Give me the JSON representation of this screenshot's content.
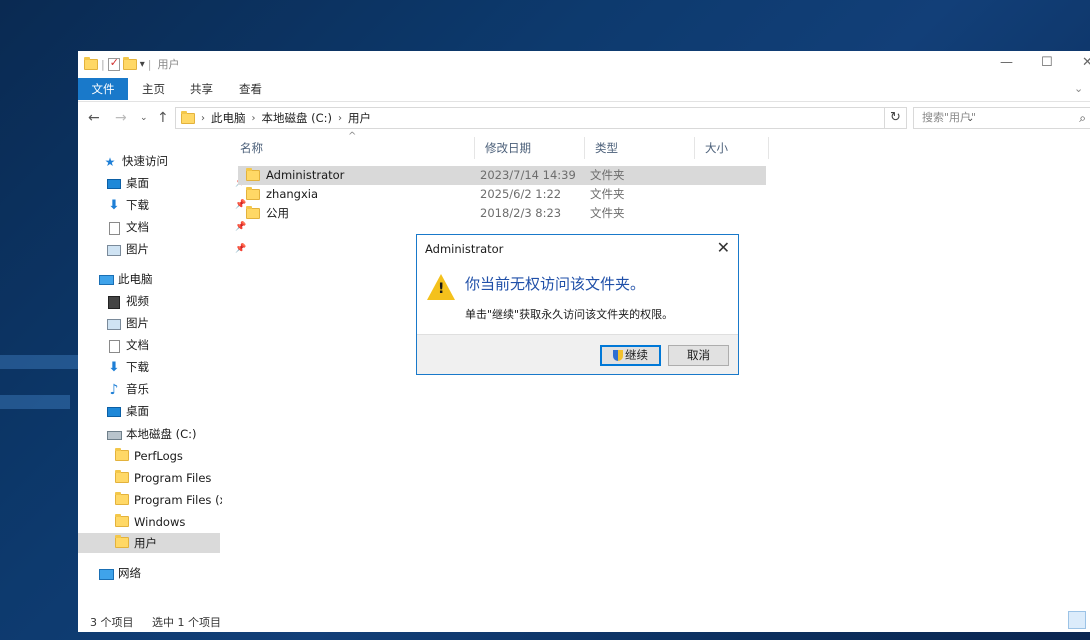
{
  "window": {
    "title": "用户",
    "controls": {
      "minimize": "—",
      "maximize": "☐",
      "close": "✕",
      "help_chevron": "⌄"
    }
  },
  "ribbon": {
    "tabs": [
      "文件",
      "主页",
      "共享",
      "查看"
    ]
  },
  "address": {
    "segments": [
      "此电脑",
      "本地磁盘 (C:)",
      "用户"
    ],
    "search_placeholder": "搜索\"用户\""
  },
  "nav": {
    "quick_access": "快速访问",
    "quick_items": [
      "桌面",
      "下载",
      "文档",
      "图片"
    ],
    "this_pc": "此电脑",
    "pc_items": [
      "视频",
      "图片",
      "文档",
      "下载",
      "音乐",
      "桌面"
    ],
    "drive": "本地磁盘 (C:)",
    "drive_items": [
      "PerfLogs",
      "Program Files",
      "Program Files (x",
      "Windows",
      "用户"
    ],
    "network": "网络"
  },
  "columns": {
    "name": "名称",
    "date": "修改日期",
    "type": "类型",
    "size": "大小"
  },
  "files": [
    {
      "name": "Administrator",
      "date": "2023/7/14 14:39",
      "type": "文件夹"
    },
    {
      "name": "zhangxia",
      "date": "2025/6/2 1:22",
      "type": "文件夹"
    },
    {
      "name": "公用",
      "date": "2018/2/3 8:23",
      "type": "文件夹"
    }
  ],
  "status": {
    "count": "3 个项目",
    "selected": "选中 1 个项目"
  },
  "dialog": {
    "title": "Administrator",
    "message": "你当前无权访问该文件夹。",
    "detail": "单击\"继续\"获取永久访问该文件夹的权限。",
    "continue": "继续",
    "cancel": "取消",
    "close": "✕"
  },
  "colors": {
    "accent": "#1979ca",
    "folder": "#ffd866",
    "dialog_heading": "#1f4fa8"
  }
}
